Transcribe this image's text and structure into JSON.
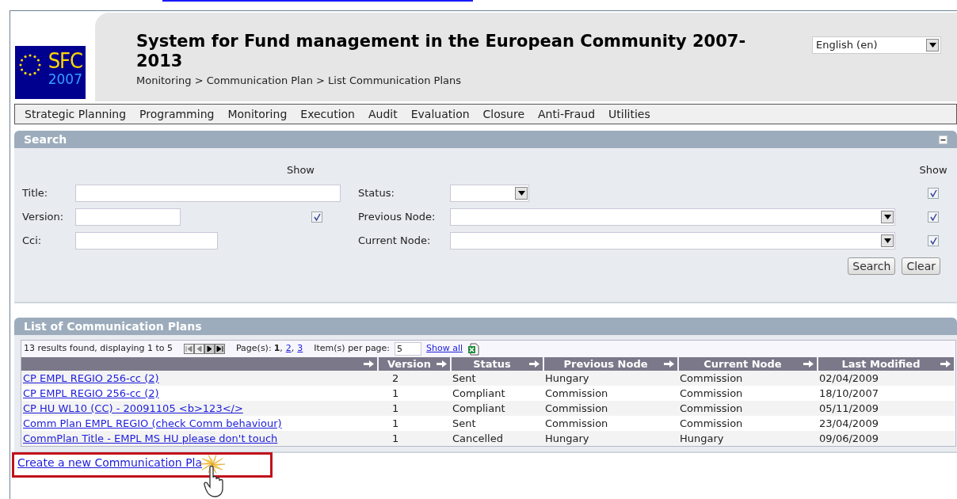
{
  "header": {
    "logo": {
      "word": "SFC",
      "year": "2007"
    },
    "title": "System for Fund management in the European Community 2007-2013",
    "breadcrumb": "Monitoring > Communication Plan > List Communication Plans",
    "language": "English (en)"
  },
  "menu": [
    "Strategic Planning",
    "Programming",
    "Monitoring",
    "Execution",
    "Audit",
    "Evaluation",
    "Closure",
    "Anti-Fraud",
    "Utilities"
  ],
  "search": {
    "title": "Search",
    "show_label_left": "Show",
    "show_label_right": "Show",
    "fields_left": [
      {
        "label": "Title:",
        "kind": "text"
      },
      {
        "label": "Version:",
        "kind": "text",
        "show_checked": true
      },
      {
        "label": "Cci:",
        "kind": "text"
      }
    ],
    "fields_right": [
      {
        "label": "Status:",
        "kind": "select",
        "show_checked": true
      },
      {
        "label": "Previous Node:",
        "kind": "select",
        "show_checked": true
      },
      {
        "label": "Current Node:",
        "kind": "select",
        "show_checked": true
      }
    ],
    "buttons": [
      "Search",
      "Clear"
    ]
  },
  "list": {
    "title": "List of Communication Plans",
    "summary": "13 results found, displaying 1 to 5",
    "pager_buttons": [
      {
        "kind": "first",
        "disabled": true
      },
      {
        "kind": "prev",
        "disabled": true
      },
      {
        "kind": "next",
        "disabled": false
      },
      {
        "kind": "last",
        "disabled": false
      }
    ],
    "pages_label": "Page(s):",
    "page_separator": ",",
    "pages": [
      {
        "label": "1",
        "selected": true
      },
      {
        "label": "2",
        "selected": false
      },
      {
        "label": "3",
        "selected": false
      }
    ],
    "per_page_label": "Item(s) per page:",
    "per_page": "5",
    "show_all": "Show all",
    "columns": [
      "Version",
      "Status",
      "Previous Node",
      "Current Node",
      "Last Modified"
    ],
    "rows": [
      {
        "title": "CP EMPL REGIO 256-cc (2)",
        "version": "2",
        "status": "Sent",
        "previous_node": "Hungary",
        "current_node": "Commission",
        "last_modified": "02/04/2009"
      },
      {
        "title": "CP EMPL REGIO 256-cc (2)",
        "version": "1",
        "status": "Compliant",
        "previous_node": "Commission",
        "current_node": "Commission",
        "last_modified": "18/10/2007"
      },
      {
        "title": "CP HU WL10 (CC) - 20091105 <b>123</>",
        "version": "1",
        "status": "Compliant",
        "previous_node": "Commission",
        "current_node": "Commission",
        "last_modified": "05/11/2009"
      },
      {
        "title": "Comm Plan EMPL REGIO (check Comm behaviour)",
        "version": "1",
        "status": "Sent",
        "previous_node": "Commission",
        "current_node": "Commission",
        "last_modified": "23/04/2009"
      },
      {
        "title": "CommPlan Title - EMPL MS HU please don't touch",
        "version": "1",
        "status": "Cancelled",
        "previous_node": "Hungary",
        "current_node": "Hungary",
        "last_modified": "09/06/2009"
      }
    ]
  },
  "create_link": "Create a new Communication Pla"
}
